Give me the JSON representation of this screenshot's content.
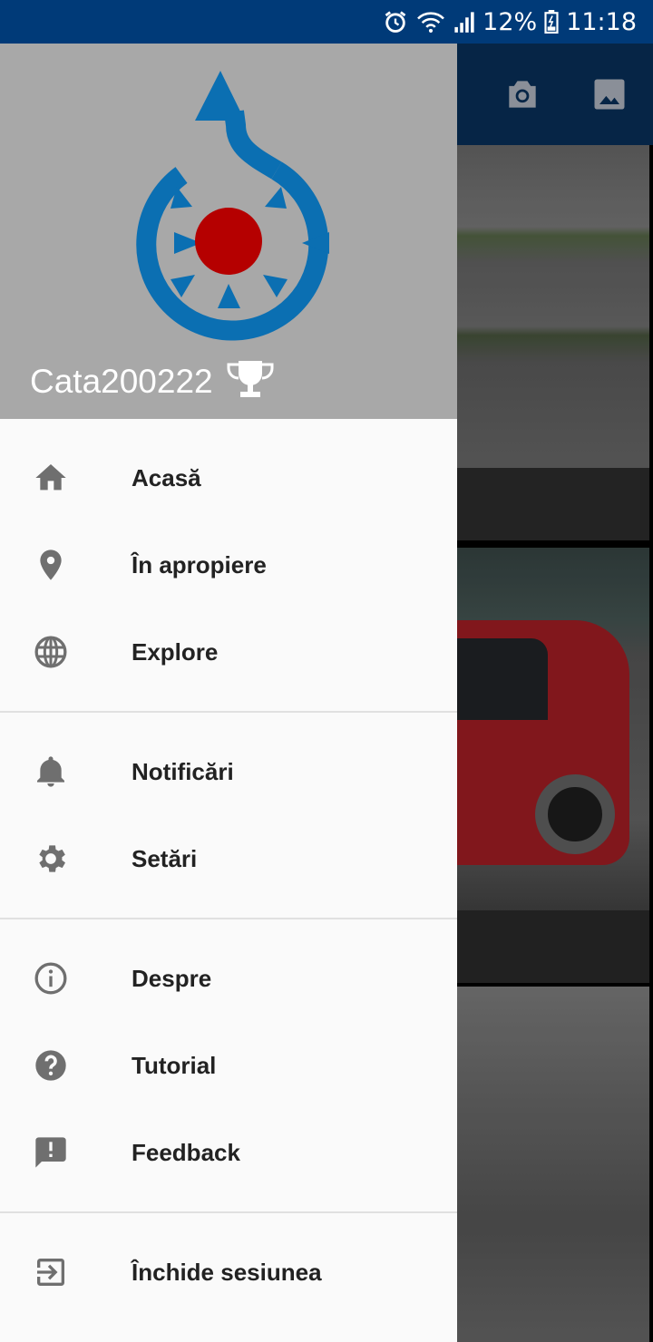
{
  "status_bar": {
    "battery_percent": "12%",
    "time": "11:18",
    "icons": [
      "alarm-icon",
      "wifi-icon",
      "signal-icon",
      "battery-icon"
    ]
  },
  "app_bar": {
    "actions": [
      "camera-icon",
      "gallery-icon"
    ]
  },
  "drawer": {
    "username": "Cata200222",
    "menu_groups": [
      [
        {
          "icon": "home-icon",
          "label": "Acasă"
        },
        {
          "icon": "location-pin-icon",
          "label": "În apropiere"
        },
        {
          "icon": "globe-icon",
          "label": "Explore"
        }
      ],
      [
        {
          "icon": "bell-icon",
          "label": "Notificări"
        },
        {
          "icon": "gear-icon",
          "label": "Setări"
        }
      ],
      [
        {
          "icon": "info-icon",
          "label": "Despre"
        },
        {
          "icon": "help-icon",
          "label": "Tutorial"
        },
        {
          "icon": "feedback-icon",
          "label": "Feedback"
        }
      ],
      [
        {
          "icon": "logout-icon",
          "label": "Închide sesiunea"
        }
      ]
    ]
  },
  "colors": {
    "status_bar": "#003a78",
    "app_bar": "#062546",
    "drawer_header": "#a8a8a8",
    "logo_blue": "#0b6fb2",
    "logo_red": "#b50000",
    "icon_gray": "#6f6f6f"
  }
}
